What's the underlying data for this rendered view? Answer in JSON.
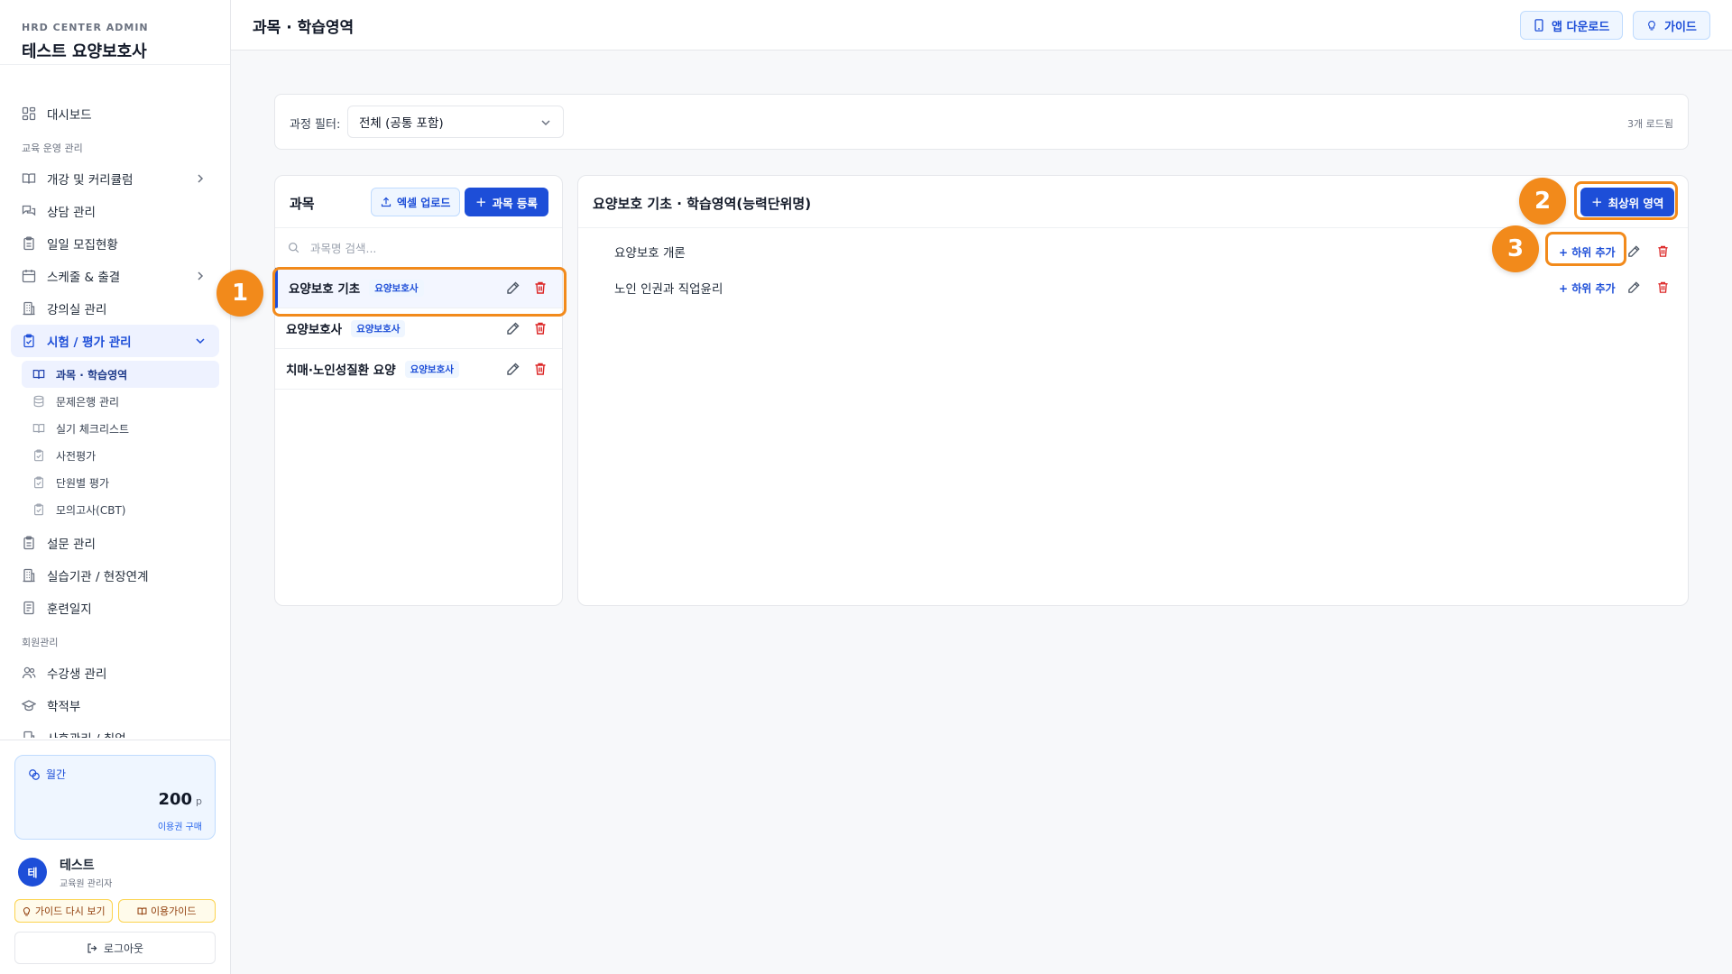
{
  "sidebar": {
    "brand_sub": "HRD CENTER ADMIN",
    "brand_title": "테스트 요양보호사",
    "dashboard": "대시보드",
    "group_edu": "교육 운영 관리",
    "items_edu": [
      {
        "label": "개강 및 커리큘럼"
      },
      {
        "label": "상담 관리"
      },
      {
        "label": "일일 모집현황"
      },
      {
        "label": "스케줄 & 출결"
      },
      {
        "label": "강의실 관리"
      },
      {
        "label": "시험 / 평가 관리"
      }
    ],
    "sub_items": [
      {
        "label": "과목 · 학습영역"
      },
      {
        "label": "문제은행 관리"
      },
      {
        "label": "실기 체크리스트"
      },
      {
        "label": "사전평가"
      },
      {
        "label": "단원별 평가"
      },
      {
        "label": "모의고사(CBT)"
      }
    ],
    "items_edu2": [
      {
        "label": "설문 관리"
      },
      {
        "label": "실습기관 / 현장연계"
      },
      {
        "label": "훈련일지"
      }
    ],
    "group_member": "회원관리",
    "items_member": [
      {
        "label": "수강생 관리"
      },
      {
        "label": "학적부"
      },
      {
        "label": "사후관리 / 취업"
      }
    ],
    "plan_label": "월간",
    "points": "200",
    "points_unit": "p",
    "buy_label": "이용권 구매",
    "user_initial": "테",
    "user_name": "테스트",
    "user_role": "교육원 관리자",
    "guide_again": "가이드 다시 보기",
    "usage_guide": "이용가이드",
    "logout": "로그아웃"
  },
  "header": {
    "title": "과목 · 학습영역",
    "app_download": "앱 다운로드",
    "guide": "가이드"
  },
  "filter": {
    "label": "과정 필터:",
    "selected": "전체 (공통 포함)",
    "loaded_count": "3개 로드됨"
  },
  "subjects_panel": {
    "title": "과목",
    "excel_upload": "엑셀 업로드",
    "add_subject": "과목 등록",
    "search_placeholder": "과목명 검색...",
    "subjects": [
      {
        "name": "요양보호 기초",
        "tag": "요양보호사"
      },
      {
        "name": "요양보호사",
        "tag": "요양보호사"
      },
      {
        "name": "치매·노인성질환 요양",
        "tag": "요양보호사"
      }
    ]
  },
  "areas_panel": {
    "title": "요양보호 기초 · 학습영역(능력단위명)",
    "add_top": "최상위 영역",
    "areas": [
      {
        "name": "요양보호 개론",
        "add_child": "+ 하위 추가"
      },
      {
        "name": "노인 인권과 직업윤리",
        "add_child": "+ 하위 추가"
      }
    ]
  },
  "callouts": {
    "one": "1",
    "two": "2",
    "three": "3"
  },
  "colors": {
    "primary": "#1d4ed8",
    "highlight": "#f28a1b",
    "danger": "#dc2626"
  }
}
